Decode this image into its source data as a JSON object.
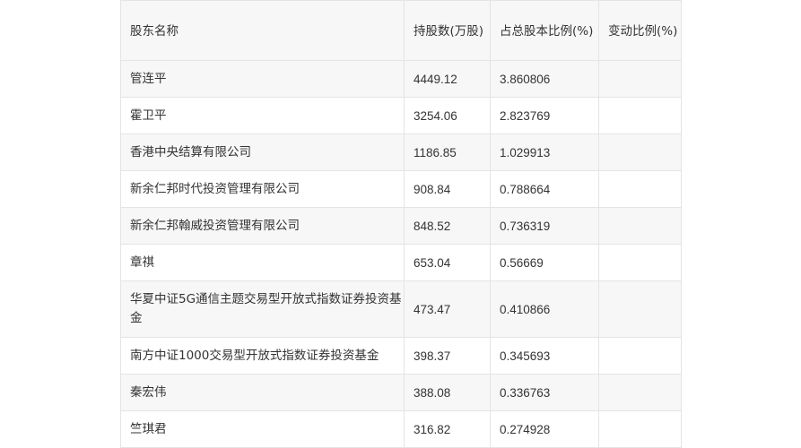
{
  "table": {
    "headers": [
      "股东名称",
      "持股数(万股)",
      "占总股本比例(%)",
      "变动比例(%)"
    ],
    "rows": [
      {
        "name": "管连平",
        "shares": "4449.12",
        "ratio": "3.860806",
        "change": ""
      },
      {
        "name": "霍卫平",
        "shares": "3254.06",
        "ratio": "2.823769",
        "change": ""
      },
      {
        "name": "香港中央结算有限公司",
        "shares": "1186.85",
        "ratio": "1.029913",
        "change": ""
      },
      {
        "name": "新余仁邦时代投资管理有限公司",
        "shares": "908.84",
        "ratio": "0.788664",
        "change": ""
      },
      {
        "name": "新余仁邦翰威投资管理有限公司",
        "shares": "848.52",
        "ratio": "0.736319",
        "change": ""
      },
      {
        "name": "章祺",
        "shares": "653.04",
        "ratio": "0.56669",
        "change": ""
      },
      {
        "name": "华夏中证5G通信主题交易型开放式指数证券投资基金",
        "shares": "473.47",
        "ratio": "0.410866",
        "change": ""
      },
      {
        "name": "南方中证1000交易型开放式指数证券投资基金",
        "shares": "398.37",
        "ratio": "0.345693",
        "change": ""
      },
      {
        "name": "秦宏伟",
        "shares": "388.08",
        "ratio": "0.336763",
        "change": ""
      },
      {
        "name": "竺琪君",
        "shares": "316.82",
        "ratio": "0.274928",
        "change": ""
      }
    ]
  }
}
